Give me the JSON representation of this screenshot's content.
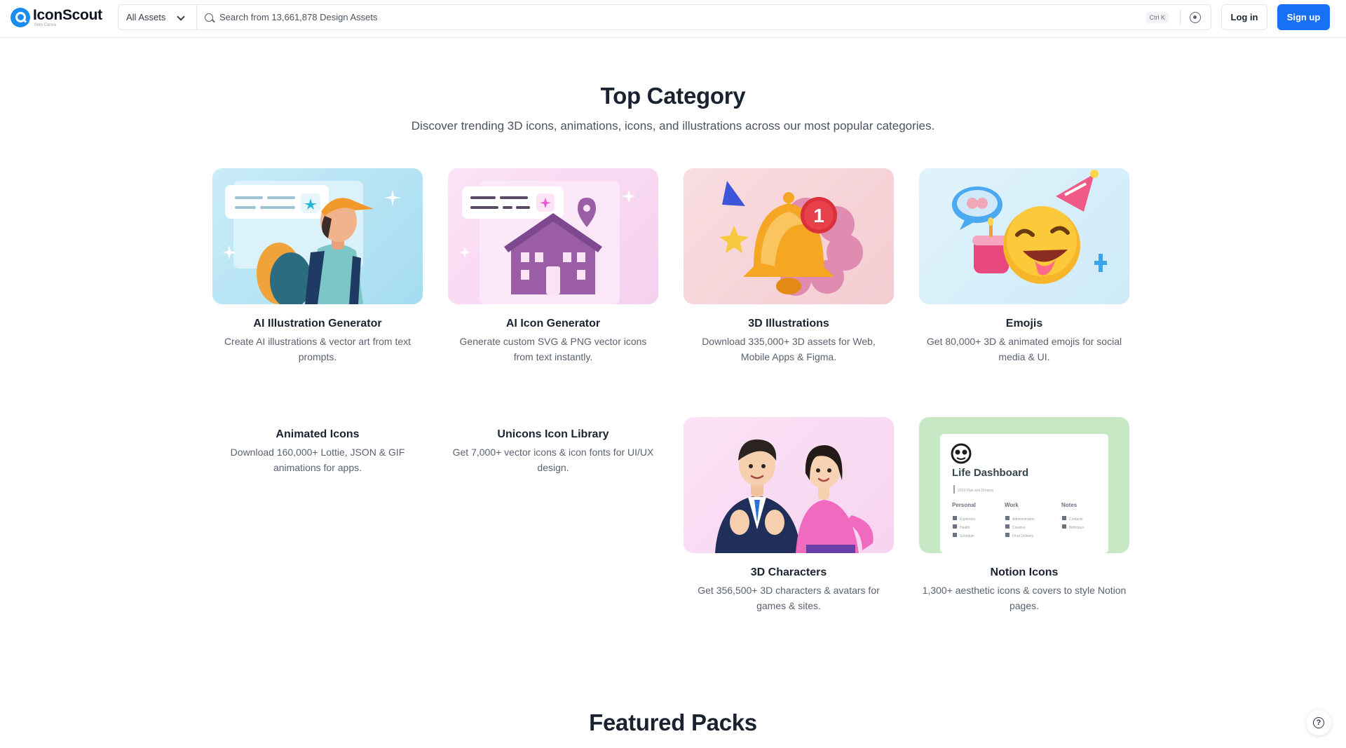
{
  "header": {
    "logo_text": "IconScout",
    "logo_sub": "from Canva",
    "asset_filter": "All Assets",
    "search_placeholder": "Search from 13,661,878 Design Assets",
    "shortcut": "Ctrl K",
    "login_label": "Log in",
    "signup_label": "Sign up",
    "accent_color": "#1770f5"
  },
  "top_category": {
    "title": "Top Category",
    "subtitle": "Discover trending 3D icons, animations, icons, and illustrations across our most popular categories.",
    "cards": [
      {
        "title": "AI Illustration Generator",
        "desc": "Create AI illustrations & vector art from text prompts."
      },
      {
        "title": "AI Icon Generator",
        "desc": "Generate custom SVG & PNG vector icons from text instantly."
      },
      {
        "title": "3D Illustrations",
        "desc": "Download 335,000+ 3D assets for Web, Mobile Apps & Figma."
      },
      {
        "title": "Emojis",
        "desc": "Get 80,000+ 3D & animated emojis for social media & UI."
      },
      {
        "title": "Animated Icons",
        "desc": "Download 160,000+ Lottie, JSON & GIF animations for apps."
      },
      {
        "title": "Unicons Icon Library",
        "desc": "Get 7,000+ vector icons & icon fonts for UI/UX design."
      },
      {
        "title": "3D Characters",
        "desc": "Get 356,500+ 3D characters & avatars for games & sites."
      },
      {
        "title": "Notion Icons",
        "desc": "1,300+ aesthetic icons & covers to style Notion pages."
      }
    ],
    "thumb_labels": {
      "bell_badge": "1",
      "notion_title": "Life Dashboard",
      "notion_caption": "2023 Plan and Dreams",
      "notion_columns": [
        "Personal",
        "Work",
        "Notes"
      ],
      "notion_personal": [
        "Expenses",
        "Health",
        "Schedule"
      ],
      "notion_work": [
        "Administration",
        "Creative",
        "Final Delivery"
      ],
      "notion_notes": [
        "Contacts",
        "Birthdays"
      ]
    }
  },
  "featured": {
    "title": "Featured Packs"
  },
  "help": {
    "icon": "help-icon"
  }
}
